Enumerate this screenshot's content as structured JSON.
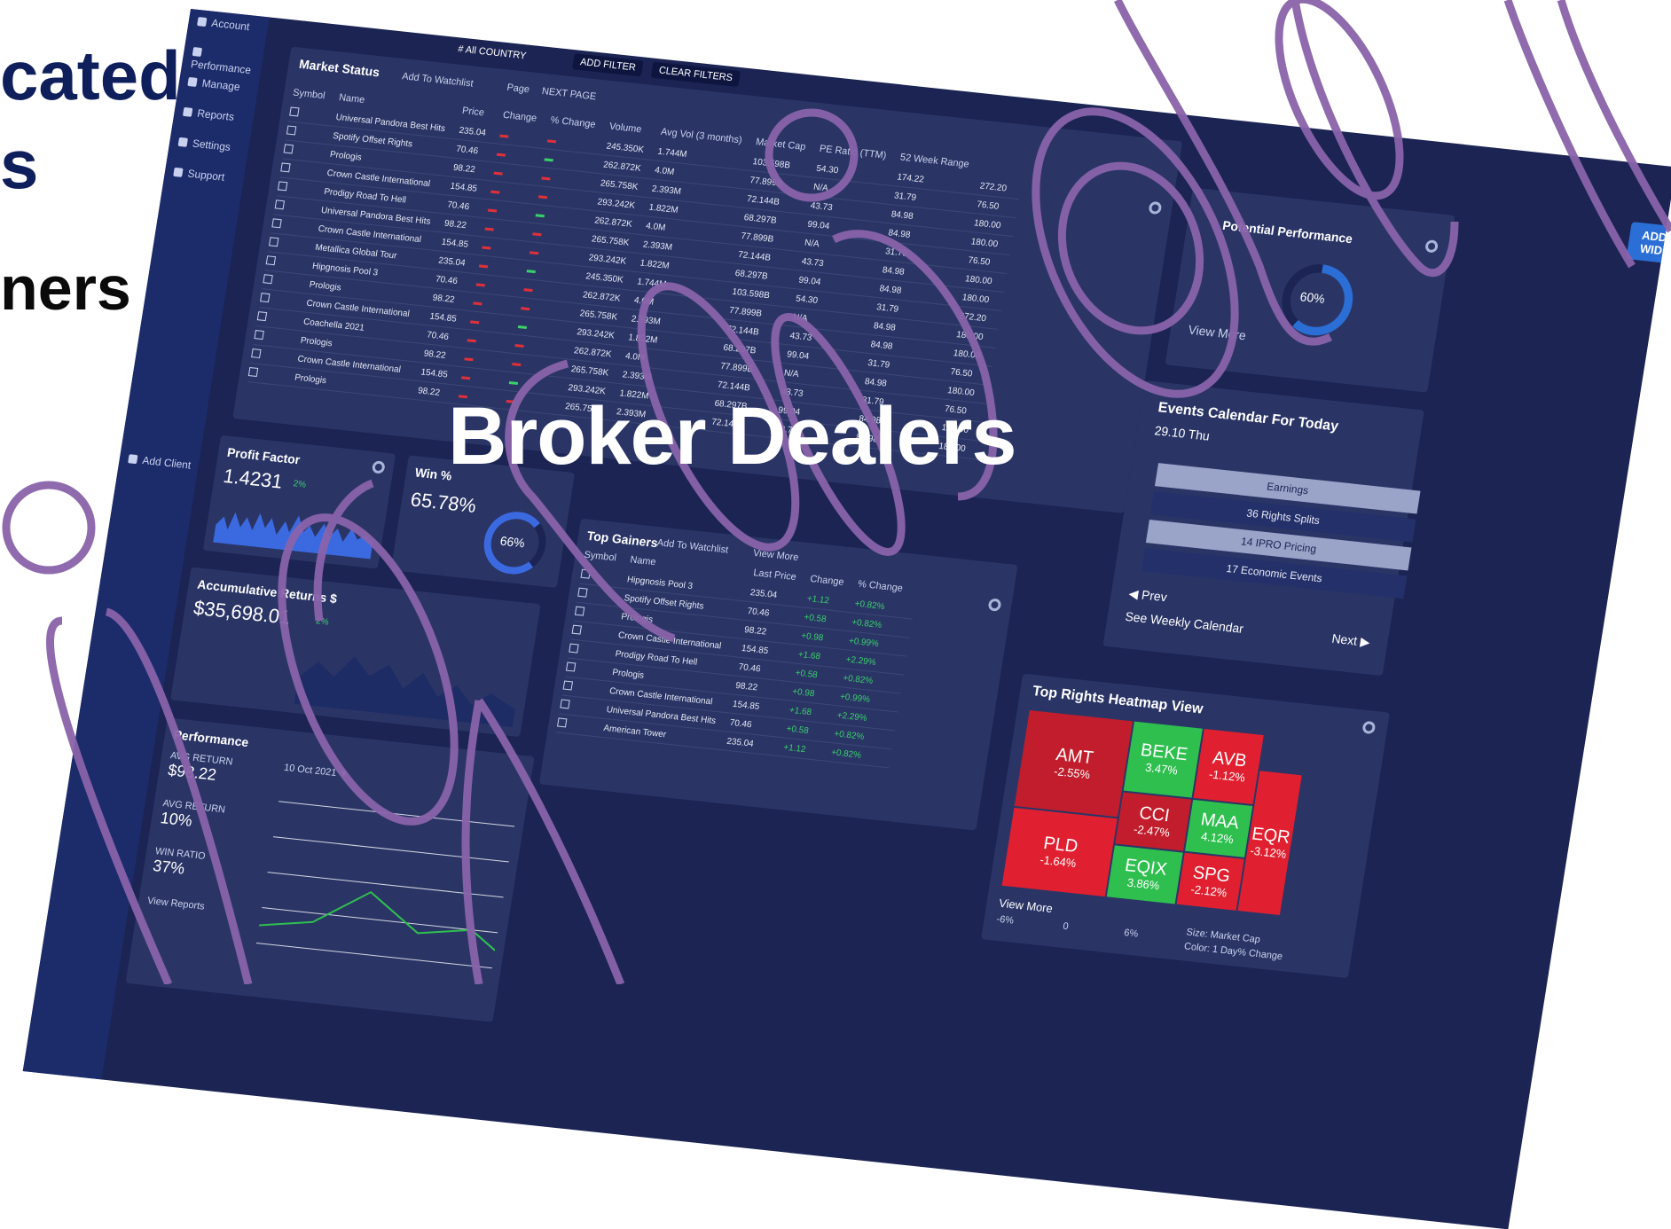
{
  "hero": {
    "line1": "cated",
    "line2": "s",
    "line3": "ners"
  },
  "headline": "Broker Dealers",
  "sidebar": {
    "items": [
      {
        "label": "Account",
        "icon": "account-icon"
      },
      {
        "label": "Performance",
        "icon": "performance-icon"
      },
      {
        "label": "Manage",
        "icon": "manage-icon"
      },
      {
        "label": "Reports",
        "icon": "reports-icon"
      },
      {
        "label": "Settings",
        "icon": "settings-icon"
      },
      {
        "label": "Support",
        "icon": "support-icon"
      }
    ],
    "add_client": "Add Client"
  },
  "toolbar": {
    "country": "# All COUNTRY",
    "add_filter": "ADD FILTER",
    "clear_filters": "CLEAR FILTERS",
    "add_widget": "ADD WIDGET"
  },
  "market_status": {
    "title": "Market Status",
    "add_watchlist": "Add To Watchlist",
    "page": "Page",
    "next_page": "NEXT PAGE",
    "columns": [
      "Symbol",
      "Name",
      "Price",
      "Change",
      "% Change",
      "Volume",
      "Avg Vol (3 months)",
      "Market Cap",
      "PE Ratio (TTM)",
      "52 Week Range"
    ],
    "rows": [
      [
        "Universal Pandora Best Hits",
        "235.04",
        "245.350K",
        "1.744M",
        "103.598B",
        "54.30"
      ],
      [
        "Spotify Offset Rights",
        "70.46",
        "262.872K",
        "4.0M",
        "77.899B",
        "N/A"
      ],
      [
        "Prologis",
        "98.22",
        "265.758K",
        "2.393M",
        "72.144B",
        "43.73"
      ],
      [
        "Crown Castle International",
        "154.85",
        "293.242K",
        "1.822M",
        "68.297B",
        "99.04"
      ],
      [
        "Prodigy Road To Hell",
        "70.46",
        "262.872K",
        "4.0M",
        "77.899B",
        "N/A"
      ],
      [
        "Universal Pandora Best Hits",
        "98.22",
        "265.758K",
        "2.393M",
        "72.144B",
        "43.73"
      ],
      [
        "Crown Castle International",
        "154.85",
        "293.242K",
        "1.822M",
        "68.297B",
        "99.04"
      ],
      [
        "Metallica Global Tour",
        "235.04",
        "245.350K",
        "1.744M",
        "103.598B",
        "54.30"
      ],
      [
        "Hipgnosis Pool 3",
        "70.46",
        "262.872K",
        "4.0M",
        "77.899B",
        "N/A"
      ],
      [
        "Prologis",
        "98.22",
        "265.758K",
        "2.393M",
        "72.144B",
        "43.73"
      ],
      [
        "Crown Castle International",
        "154.85",
        "293.242K",
        "1.822M",
        "68.297B",
        "99.04"
      ],
      [
        "Coachella 2021",
        "70.46",
        "262.872K",
        "4.0M",
        "77.899B",
        "N/A"
      ],
      [
        "Prologis",
        "98.22",
        "265.758K",
        "2.393M",
        "72.144B",
        "43.73"
      ],
      [
        "Crown Castle International",
        "154.85",
        "293.242K",
        "1.822M",
        "68.297B",
        "99.04"
      ],
      [
        "Prologis",
        "98.22",
        "265.758K",
        "2.393M",
        "72.144B",
        "43.73"
      ]
    ],
    "range_low": [
      "174.22",
      "31.79",
      "84.98",
      "84.98",
      "31.79",
      "84.98",
      "84.98",
      "31.79",
      "84.98",
      "84.98",
      "31.79",
      "84.98",
      "31.79",
      "84.98",
      "84.98"
    ],
    "range_high": [
      "272.20",
      "76.50",
      "180.00",
      "180.00",
      "76.50",
      "180.00",
      "180.00",
      "272.20",
      "180.00",
      "180.00",
      "76.50",
      "180.00",
      "76.50",
      "180.00",
      "180.00"
    ]
  },
  "potential_performance": {
    "title": "Potential Performance",
    "value": "60%",
    "fraction": 0.6,
    "view_more": "View More"
  },
  "events": {
    "title": "Events Calendar For Today",
    "date": "29.10 Thu",
    "items": [
      "Earnings",
      "36 Rights Splits",
      "14 IPRO Pricing",
      "17 Economic Events"
    ],
    "prev": "Prev",
    "next": "Next",
    "weekly": "See Weekly Calendar"
  },
  "profit_factor": {
    "title": "Profit Factor",
    "value": "1.4231",
    "delta": "2%"
  },
  "win_pct": {
    "title": "Win %",
    "value": "65.78%",
    "gauge": "66%"
  },
  "accumulative": {
    "title": "Accumulative Returns $",
    "value": "$35,698.01",
    "delta": "2%"
  },
  "top_gainers": {
    "title": "Top Gainers",
    "add_watchlist": "Add To Watchlist",
    "view_more": "View More",
    "columns": [
      "Symbol",
      "Name",
      "Last Price",
      "Change",
      "% Change"
    ],
    "rows": [
      [
        "Hipgnosis Pool 3",
        "235.04",
        "+1.12",
        "+0.82%"
      ],
      [
        "Spotify Offset Rights",
        "70.46",
        "+0.58",
        "+0.82%"
      ],
      [
        "Prologis",
        "98.22",
        "+0.98",
        "+0.99%"
      ],
      [
        "Crown Castle International",
        "154.85",
        "+1.68",
        "+2.29%"
      ],
      [
        "Prodigy Road To Hell",
        "70.46",
        "+0.58",
        "+0.82%"
      ],
      [
        "Prologis",
        "98.22",
        "+0.98",
        "+0.99%"
      ],
      [
        "Crown Castle International",
        "154.85",
        "+1.68",
        "+2.29%"
      ],
      [
        "Universal Pandora Best Hits",
        "70.46",
        "+0.58",
        "+0.82%"
      ],
      [
        "American Tower",
        "235.04",
        "+1.12",
        "+0.82%"
      ]
    ]
  },
  "performance": {
    "title": "Performance",
    "stats": [
      {
        "label": "AVG RETURN",
        "value": "$98.22"
      },
      {
        "label": "AVG RETURN",
        "value": "10%"
      },
      {
        "label": "WIN RATIO",
        "value": "37%"
      }
    ],
    "view_reports": "View Reports",
    "date": "10 Oct 2021"
  },
  "heatmap": {
    "title": "Top Rights Heatmap View",
    "cells": [
      {
        "ticker": "AMT",
        "pct": "-2.55%",
        "color": "#c21d2c"
      },
      {
        "ticker": "BEKE",
        "pct": "3.47%",
        "color": "#2fbf4f"
      },
      {
        "ticker": "AVB",
        "pct": "-1.12%",
        "color": "#e02030"
      },
      {
        "ticker": "MAA",
        "pct": "4.12%",
        "color": "#2fbf4f"
      },
      {
        "ticker": "CCI",
        "pct": "-2.47%",
        "color": "#c21d2c"
      },
      {
        "ticker": "PLD",
        "pct": "-1.64%",
        "color": "#e02030"
      },
      {
        "ticker": "SPG",
        "pct": "-2.12%",
        "color": "#e02030"
      },
      {
        "ticker": "EQIX",
        "pct": "3.86%",
        "color": "#2fbf4f"
      },
      {
        "ticker": "EQR",
        "pct": "-3.12%",
        "color": "#e02030"
      }
    ],
    "view_more": "View More",
    "scale": [
      "-6%",
      "0",
      "6%"
    ],
    "size_label": "Size: Market Cap",
    "color_label": "Color: 1 Day% Change"
  },
  "colors": {
    "accent": "#2b6fd6",
    "panel": "#2a3566",
    "background": "#1b2453",
    "positive": "#3ad06a",
    "negative": "#e0303a",
    "watermark": "#8a64aa"
  }
}
